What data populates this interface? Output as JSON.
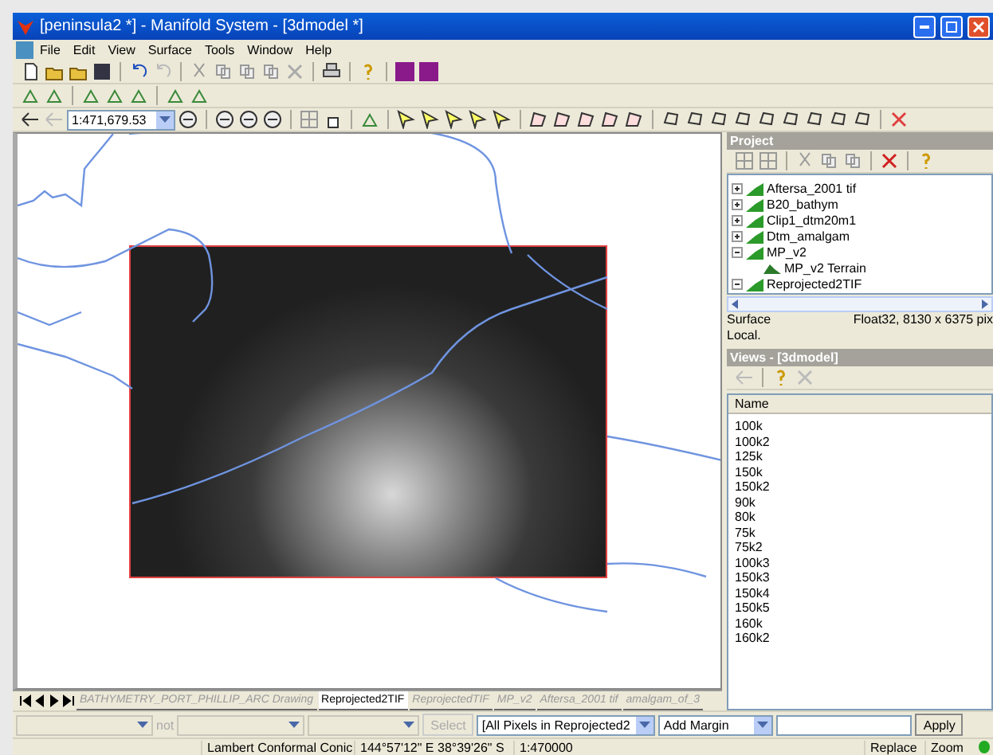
{
  "window": {
    "title": "[peninsula2 *] - Manifold System - [3dmodel *]"
  },
  "menu": [
    "File",
    "Edit",
    "View",
    "Surface",
    "Tools",
    "Window",
    "Help"
  ],
  "scale_field": {
    "value": "1:471,679.53"
  },
  "project": {
    "title": "Project",
    "tree": [
      {
        "label": "Aftersa_2001 tif",
        "expanded": false
      },
      {
        "label": "B20_bathym",
        "expanded": false
      },
      {
        "label": "Clip1_dtm20m1",
        "expanded": false
      },
      {
        "label": "Dtm_amalgam",
        "expanded": false
      },
      {
        "label": "MP_v2",
        "expanded": true,
        "children": [
          {
            "label": "MP_v2 Terrain"
          }
        ]
      },
      {
        "label": "Reprojected2TIF",
        "expanded": true
      }
    ],
    "info_type": "Surface",
    "info_detail": "Float32, 8130 x 6375 pix",
    "info_scope": "Local."
  },
  "views": {
    "title": "Views - [3dmodel]",
    "column": "Name",
    "items": [
      "100k",
      "100k2",
      "125k",
      "150k",
      "150k2",
      "90k",
      "80k",
      "75k",
      "75k2",
      "100k3",
      "150k3",
      "150k4",
      "150k5",
      "160k",
      "160k2"
    ]
  },
  "map_tabs": [
    {
      "label": "BATHYMETRY_PORT_PHILLIP_ARC Drawing",
      "selected": false
    },
    {
      "label": "Reprojected2TIF",
      "selected": true
    },
    {
      "label": "ReprojectedTIF",
      "selected": false
    },
    {
      "label": "MP_v2",
      "selected": false
    },
    {
      "label": "Aftersa_2001 tif",
      "selected": false
    },
    {
      "label": "amalgam_of_3",
      "selected": false
    }
  ],
  "selection_bar": {
    "not_label": "not",
    "select_button": "Select",
    "pixels_field": "[All Pixels in Reprojected2",
    "margin_field": "Add Margin",
    "apply_button": "Apply"
  },
  "status_bar": {
    "projection": "Lambert Conformal Conic",
    "coordinates": "144°57'12\" E 38°39'26\" S",
    "scale": "1:470000",
    "mode": "Replace",
    "tool": "Zoom"
  }
}
